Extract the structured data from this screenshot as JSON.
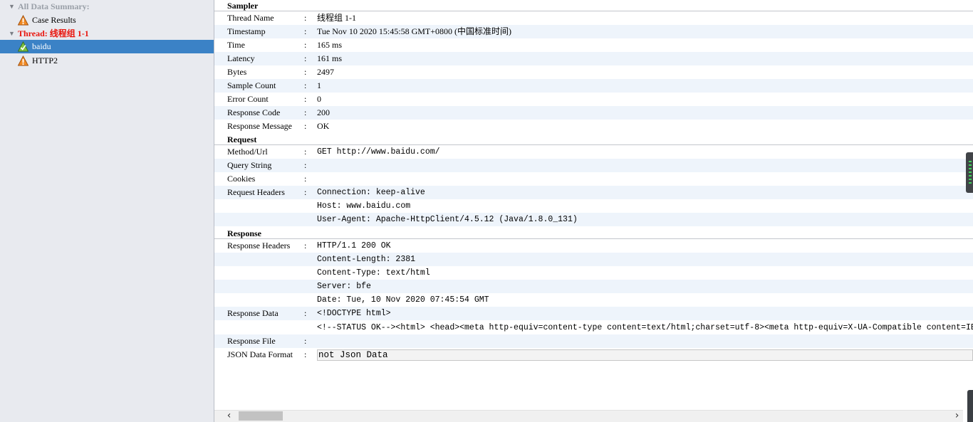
{
  "tree": {
    "summary_label": "All Data Summary:",
    "case_results_label": "Case Results",
    "thread_label": "Thread: 线程组 1-1",
    "items": [
      {
        "label": "baidu",
        "status": "success"
      },
      {
        "label": "HTTP2",
        "status": "warning"
      }
    ]
  },
  "sampler": {
    "header": "Sampler",
    "thread_name": {
      "key": "Thread Name",
      "value": "线程组 1-1"
    },
    "timestamp": {
      "key": "Timestamp",
      "value": "Tue Nov 10 2020 15:45:58 GMT+0800 (中国标准时间)"
    },
    "time": {
      "key": "Time",
      "value": "165 ms"
    },
    "latency": {
      "key": "Latency",
      "value": "161 ms"
    },
    "bytes": {
      "key": "Bytes",
      "value": "2497"
    },
    "sample_count": {
      "key": "Sample Count",
      "value": "1"
    },
    "error_count": {
      "key": "Error Count",
      "value": "0"
    },
    "response_code": {
      "key": "Response Code",
      "value": "200"
    },
    "response_message": {
      "key": "Response Message",
      "value": "OK"
    }
  },
  "request": {
    "header": "Request",
    "method_url": {
      "key": "Method/Url",
      "value": "GET http://www.baidu.com/"
    },
    "query_string": {
      "key": "Query String",
      "value": ""
    },
    "cookies": {
      "key": "Cookies",
      "value": ""
    },
    "request_headers": {
      "key": "Request Headers",
      "lines": [
        "Connection: keep-alive",
        "Host: www.baidu.com",
        "User-Agent: Apache-HttpClient/4.5.12 (Java/1.8.0_131)"
      ]
    }
  },
  "response": {
    "header": "Response",
    "response_headers": {
      "key": "Response Headers",
      "lines": [
        "HTTP/1.1 200 OK",
        "Content-Length: 2381",
        "Content-Type: text/html",
        "Server: bfe",
        "Date: Tue, 10 Nov 2020 07:45:54 GMT"
      ]
    },
    "response_data": {
      "key": "Response Data",
      "lines": [
        "<!DOCTYPE html>",
        "<!--STATUS OK--><html> <head><meta http-equiv=content-type content=text/html;charset=utf-8><meta http-equiv=X-UA-Compatible content=IE=Edge><meta content=always name=referrer>"
      ]
    },
    "response_file": {
      "key": "Response File",
      "value": ""
    },
    "json_format": {
      "key": "JSON Data Format",
      "value": "not Json Data"
    }
  },
  "separator": ":",
  "colors": {
    "selected_row": "#3b82c6",
    "thread_label": "#e8140c",
    "alt_row": "#eef4fb",
    "sidebar_bg": "#e8eaef"
  },
  "icons": {
    "case_results": "warning-triangle-icon",
    "baidu": "success-triangle-icon",
    "HTTP2": "warning-triangle-icon"
  }
}
